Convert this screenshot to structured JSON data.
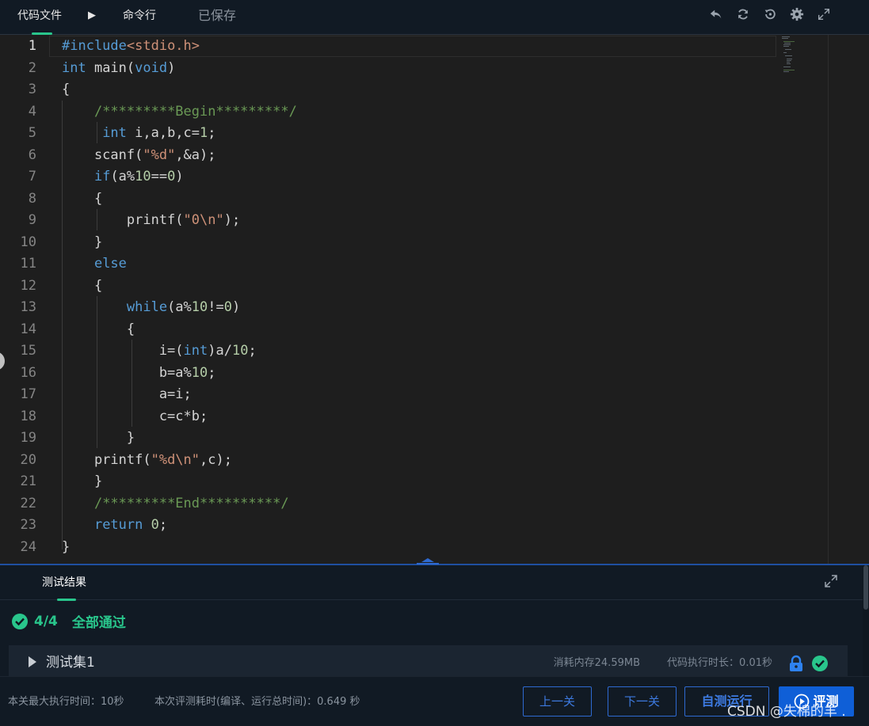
{
  "topbar": {
    "tabs": {
      "file": "代码文件",
      "command": "命令行"
    },
    "saved_status": "已保存",
    "icons": [
      "undo-icon",
      "refresh-icon",
      "restore-icon",
      "settings-icon",
      "fullscreen-icon"
    ]
  },
  "editor": {
    "line_numbers": [
      "1",
      "2",
      "3",
      "4",
      "5",
      "6",
      "7",
      "8",
      "9",
      "10",
      "11",
      "12",
      "13",
      "14",
      "15",
      "16",
      "17",
      "18",
      "19",
      "20",
      "21",
      "22",
      "23",
      "24"
    ],
    "active_line": 1,
    "language": "c"
  },
  "results": {
    "tab": "测试结果",
    "score": "4/4",
    "status": "全部通过",
    "testset": {
      "name": "测试集1",
      "memory": "消耗内存24.59MB",
      "time": "代码执行时长：0.01秒"
    }
  },
  "bottombar": {
    "max_time": "本关最大执行时间：10秒",
    "cost": "本次评测耗时(编译、运行总时间)：0.649 秒",
    "prev": "上一关",
    "next": "下一关",
    "self_test": "自测运行",
    "judge": "评测"
  },
  "watermark": "CSDN @失棉的羊 .",
  "colors": {
    "accent_green": "#29c68c",
    "accent_blue": "#0f5fd7",
    "keyword": "#569cd6",
    "string": "#ce9178",
    "number": "#b5cea8",
    "comment": "#6a9955"
  }
}
